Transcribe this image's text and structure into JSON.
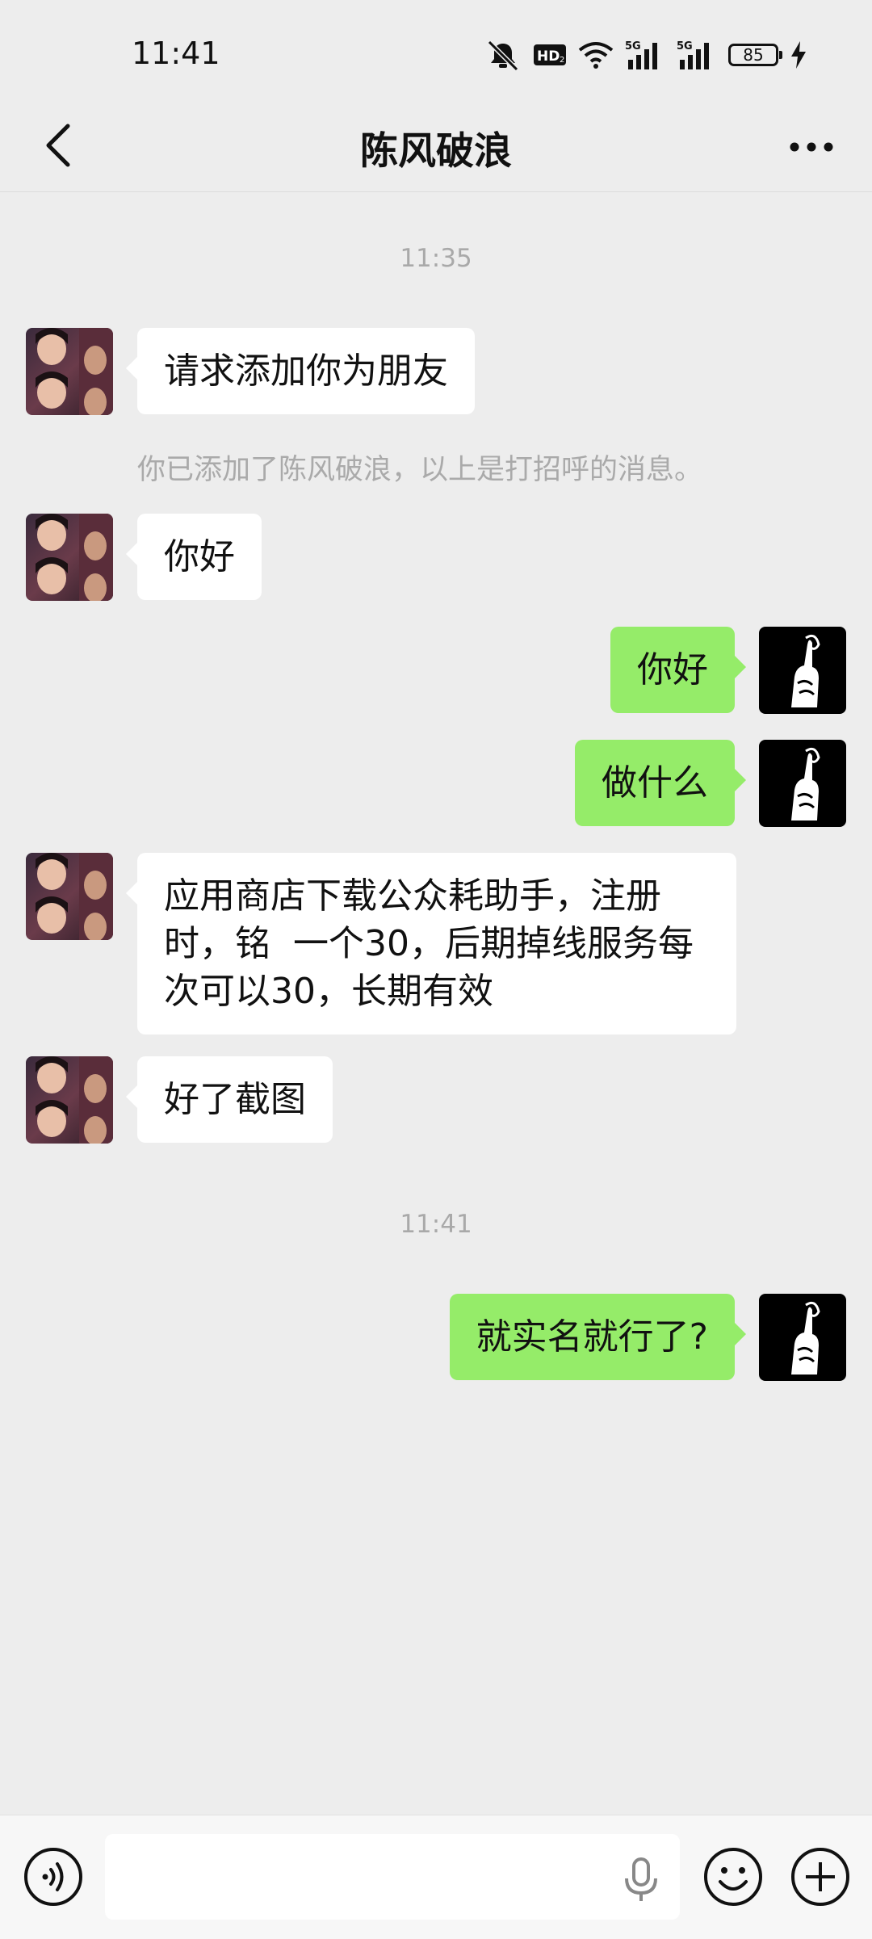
{
  "status_bar": {
    "time": "11:41",
    "battery": "85"
  },
  "header": {
    "title": "陈风破浪"
  },
  "messages": {
    "time1": "11:35",
    "m1": "请求添加你为朋友",
    "sys1": "你已添加了陈风破浪，以上是打招呼的消息。",
    "m2": "你好",
    "m3": "你好",
    "m4": "做什么",
    "m5": "应用商店下载公众耗助手，注册\n时，铭  一个30，后期掉线服务每\n次可以30，长期有效",
    "m6": "好了截图",
    "time2": "11:41",
    "m7": "就实名就行了?"
  },
  "colors": {
    "background": "#ededed",
    "outgoing_bubble": "#95ec69",
    "incoming_bubble": "#ffffff"
  },
  "icons": [
    "back-arrow-icon",
    "more-dots-icon",
    "voice-icon",
    "mic-icon",
    "emoji-icon",
    "plus-icon",
    "mute-icon",
    "hd-icon",
    "wifi-icon",
    "signal-icon",
    "battery-icon",
    "charging-icon"
  ]
}
